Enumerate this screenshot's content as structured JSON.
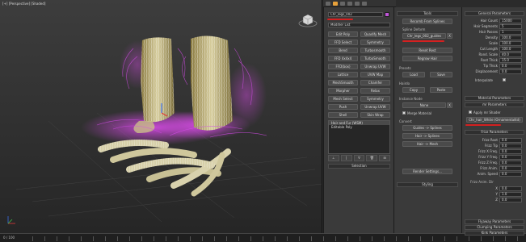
{
  "viewport": {
    "label": "[+] [Perspective] [Shaded]"
  },
  "timeline": {
    "frame_label": "0 / 100"
  },
  "modify": {
    "object_name": "Chr_legs_002",
    "modifier_list": "Modifier List",
    "buttons": [
      "Edit Poly",
      "Quadify Mesh",
      "FFD Select",
      "Symmetry",
      "Bend",
      "Turbosmooth",
      "FFD 4x4x4",
      "TurboSmooth",
      "FFD(box)",
      "Unwrap UVW",
      "Lattice",
      "UVW Map",
      "MeshSmooth",
      "Chamfer",
      "Morpher",
      "Relax",
      "Mesh Select",
      "Symmetry",
      "Push",
      "Unwrap UVW",
      "Shell",
      "Skin Wrap"
    ],
    "stack_items": [
      "Hair and Fur (WSM)",
      "Editable Poly"
    ],
    "stack_tool_icons": [
      "pin-icon",
      "show-end-icon",
      "make-unique-icon",
      "remove-icon",
      "configure-icon"
    ],
    "rollout_selection": "Selection"
  },
  "tools": {
    "header": "Tools",
    "recomb_button": "Recomb From Splines",
    "spline_deform_title": "Spline Deform",
    "spline_deform_value": "Chr_legs_002_guides",
    "reset_rest": "Reset Rest",
    "regrow_hair": "Regrow Hair",
    "presets_title": "Presets",
    "load_button": "Load",
    "save_button": "Save",
    "hairdo_title": "Hairdo",
    "copy_button": "Copy",
    "paste_button": "Paste",
    "instance_node_title": "Instance Node",
    "instance_none": "None",
    "merge_material_label": "Merge Material",
    "convert_title": "Convert",
    "guides_splines": "Guides -> Splines",
    "hair_splines": "Hair -> Splines",
    "hair_mesh": "Hair -> Mesh",
    "render_settings": "Render Settings...",
    "rollout_styling": "Styling"
  },
  "general": {
    "header": "General Parameters",
    "params": [
      {
        "label": "Hair Count",
        "value": "15000"
      },
      {
        "label": "Hair Segments",
        "value": "5"
      },
      {
        "label": "Hair Passes",
        "value": "1"
      },
      {
        "label": "Density",
        "value": "100.0"
      },
      {
        "label": "Scale",
        "value": "100.0"
      },
      {
        "label": "Cut Length",
        "value": "100.0"
      },
      {
        "label": "Rand. Scale",
        "value": "40.0"
      },
      {
        "label": "Root Thick",
        "value": "15.0"
      },
      {
        "label": "Tip Thick",
        "value": "0.0"
      },
      {
        "label": "Displacement",
        "value": "0.0"
      }
    ],
    "interpolate_label": "Interpolate",
    "material_header": "Material Parameters",
    "mr_header": "mr Parameters",
    "apply_mr_shader": "Apply mr Shader",
    "mr_shader_value": "Chr_hair_White (Ornamental4d)",
    "frizz_header": "Frizz Parameters",
    "frizz_params": [
      {
        "label": "Frizz Root",
        "value": "0.0"
      },
      {
        "label": "Frizz Tip",
        "value": "0.0"
      },
      {
        "label": "Frizz X Freq.",
        "value": "0.0"
      },
      {
        "label": "Frizz Y Freq.",
        "value": "0.0"
      },
      {
        "label": "Frizz Z Freq.",
        "value": "0.0"
      },
      {
        "label": "Frizz Anim.",
        "value": "0.0"
      },
      {
        "label": "Anim. Speed",
        "value": "0.0"
      }
    ],
    "frizz_anim_dir": "Frizz Anim. Dir",
    "dir_params": [
      {
        "label": "X",
        "value": "0.0"
      },
      {
        "label": "Y",
        "value": "1.0"
      },
      {
        "label": "Z",
        "value": "0.0"
      }
    ],
    "bottom_rollouts": [
      "Flyaway Parameters",
      "Clumping Parameters",
      "Kink Parameters"
    ]
  },
  "colors": {
    "accent": "#e7a13a",
    "swatch": "#c055d8",
    "annotation": "#d42020"
  }
}
